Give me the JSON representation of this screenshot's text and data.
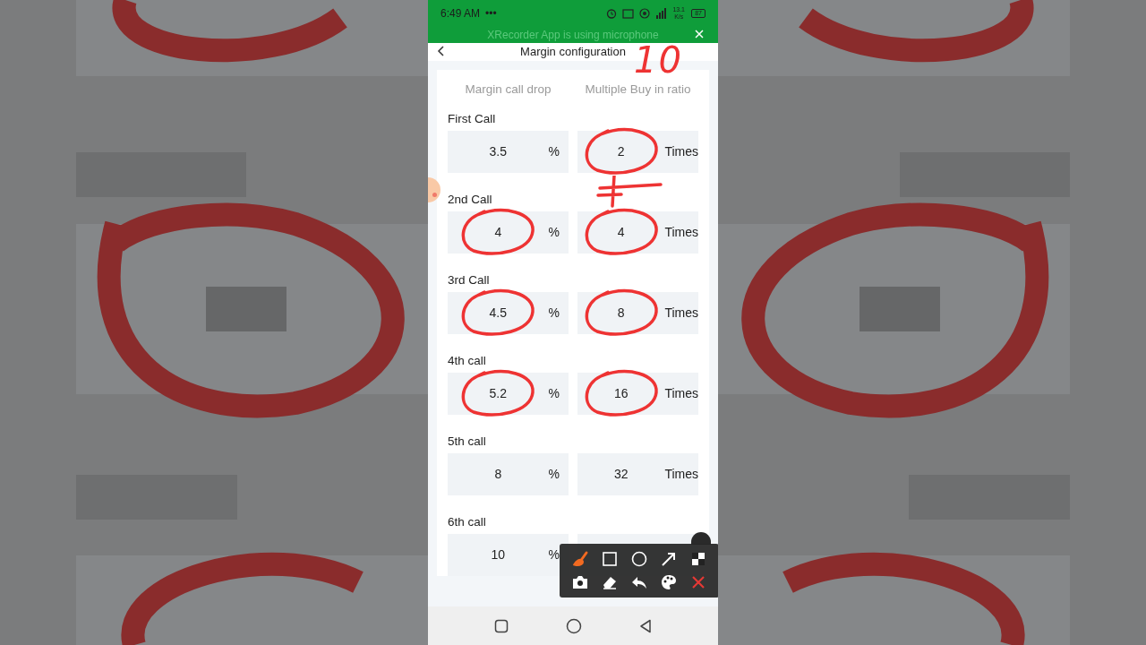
{
  "status_bar": {
    "time": "6:49 AM",
    "dots": "•••",
    "speed": "13.1 K/s",
    "battery": "87"
  },
  "notification": {
    "text": "XRecorder App is using microphone"
  },
  "header": {
    "title": "Margin configuration"
  },
  "columns": [
    "Margin call drop",
    "Multiple Buy in ratio"
  ],
  "rows": [
    {
      "label": "First Call",
      "drop": "3.5",
      "drop_unit": "%",
      "drop_circled": false,
      "ratio": "2",
      "ratio_unit": "Times",
      "ratio_circled": true
    },
    {
      "label": "2nd Call",
      "drop": "4",
      "drop_unit": "%",
      "drop_circled": true,
      "ratio": "4",
      "ratio_unit": "Times",
      "ratio_circled": true
    },
    {
      "label": "3rd Call",
      "drop": "4.5",
      "drop_unit": "%",
      "drop_circled": true,
      "ratio": "8",
      "ratio_unit": "Times",
      "ratio_circled": true
    },
    {
      "label": "4th call",
      "drop": "5.2",
      "drop_unit": "%",
      "drop_circled": true,
      "ratio": "16",
      "ratio_unit": "Times",
      "ratio_circled": true
    },
    {
      "label": "5th call",
      "drop": "8",
      "drop_unit": "%",
      "drop_circled": false,
      "ratio": "32",
      "ratio_unit": "Times",
      "ratio_circled": false
    },
    {
      "label": "6th call",
      "drop": "10",
      "drop_unit": "%",
      "drop_circled": false
    }
  ],
  "note": "10",
  "toolbar": [
    {
      "kind": "brush",
      "selected": true
    },
    {
      "kind": "square",
      "selected": false
    },
    {
      "kind": "circle",
      "selected": false
    },
    {
      "kind": "arrow",
      "selected": false
    },
    {
      "kind": "mosaic",
      "selected": false
    },
    {
      "kind": "camera",
      "selected": false
    },
    {
      "kind": "eraser",
      "selected": false
    },
    {
      "kind": "undo",
      "selected": false
    },
    {
      "kind": "palette",
      "selected": false
    },
    {
      "kind": "close",
      "selected": false
    }
  ]
}
